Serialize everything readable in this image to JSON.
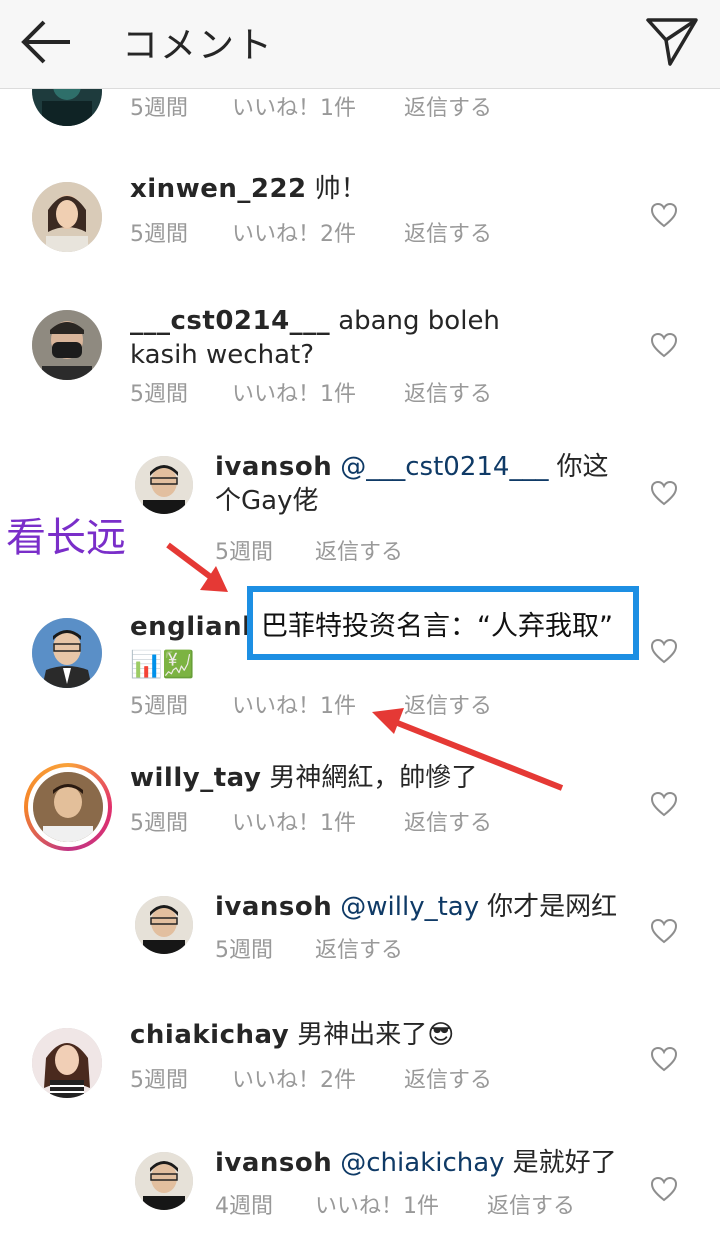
{
  "header": {
    "title": "コメント",
    "back_icon": "arrow-left-icon",
    "send_icon": "paper-plane-icon"
  },
  "comments": [
    {
      "user": "",
      "text": "",
      "time": "5週間",
      "likes": "いいね！1件",
      "reply": "返信する"
    },
    {
      "user": "xinwen_222",
      "text": "帅！",
      "time": "5週間",
      "likes": "いいね！2件",
      "reply": "返信する"
    },
    {
      "user": "___cst0214___",
      "text": "abang boleh kasih wechat?",
      "time": "5週間",
      "likes": "いいね！1件",
      "reply": "返信する"
    },
    {
      "user": "ivansoh",
      "mention": "@___cst0214___",
      "text": "你这个Gay佬",
      "time": "5週間",
      "reply": "返信する"
    },
    {
      "user": "englianhu",
      "text": "📊💹",
      "time": "5週間",
      "likes": "いいね！1件",
      "reply": "返信する"
    },
    {
      "user": "willy_tay",
      "text": "男神網紅，帥慘了",
      "time": "5週間",
      "likes": "いいね！1件",
      "reply": "返信する"
    },
    {
      "user": "ivansoh",
      "mention": "@willy_tay",
      "text": "你才是网红",
      "time": "5週間",
      "reply": "返信する"
    },
    {
      "user": "chiakichay",
      "text": "男神出来了😎",
      "time": "5週間",
      "likes": "いいね！2件",
      "reply": "返信する"
    },
    {
      "user": "ivansoh",
      "mention": "@chiakichay",
      "text": "是就好了",
      "time": "4週間",
      "likes": "いいね！1件",
      "reply": "返信する"
    }
  ],
  "annotation": {
    "label": "看长远",
    "boxed_text": "巴菲特投资名言：“人弃我取”",
    "label_color": "#7a2ec9",
    "box_color": "#1d8fe3",
    "arrow_color": "#e53935"
  }
}
